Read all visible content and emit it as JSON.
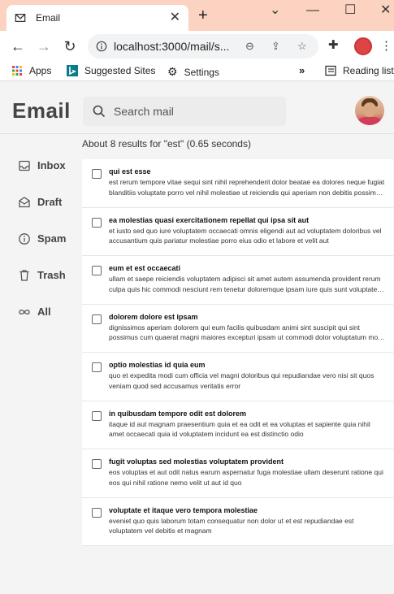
{
  "browser": {
    "tab_title": "Email",
    "url": "localhost:3000/mail/s...",
    "bookmarks": [
      {
        "label": "Apps",
        "icon": "apps-grid-icon"
      },
      {
        "label": "Suggested Sites",
        "icon": "bing-icon"
      },
      {
        "label": "Settings",
        "icon": "gear-icon"
      }
    ],
    "reading_list": "Reading list"
  },
  "app": {
    "logo": "Email",
    "search_placeholder": "Search mail",
    "results_text": "About 8 results for \"est\" (0.65 seconds)",
    "nav": [
      {
        "label": "Inbox",
        "icon": "inbox-icon"
      },
      {
        "label": "Draft",
        "icon": "draft-icon"
      },
      {
        "label": "Spam",
        "icon": "spam-icon"
      },
      {
        "label": "Trash",
        "icon": "trash-icon"
      },
      {
        "label": "All",
        "icon": "infinity-icon"
      }
    ],
    "mails": [
      {
        "subject": "qui est esse",
        "body": "est rerum tempore vitae sequi sint nihil reprehenderit dolor beatae ea dolores neque fugiat blanditiis voluptate porro vel nihil molestiae ut reiciendis qui aperiam non debitis possimus qui neque nisi nulla"
      },
      {
        "subject": "ea molestias quasi exercitationem repellat qui ipsa sit aut",
        "body": "et iusto sed quo iure voluptatem occaecati omnis eligendi aut ad voluptatem doloribus vel accusantium quis pariatur molestiae porro eius odio et labore et velit aut"
      },
      {
        "subject": "eum et est occaecati",
        "body": "ullam et saepe reiciendis voluptatem adipisci sit amet autem assumenda provident rerum culpa quis hic commodi nesciunt rem tenetur doloremque ipsam iure quis sunt voluptatem rerum illo velit"
      },
      {
        "subject": "dolorem dolore est ipsam",
        "body": "dignissimos aperiam dolorem qui eum facilis quibusdam animi sint suscipit qui sint possimus cum quaerat magni maiores excepturi ipsam ut commodi dolor voluptatum modi aut vitae"
      },
      {
        "subject": "optio molestias id quia eum",
        "body": "quo et expedita modi cum officia vel magni doloribus qui repudiandae vero nisi sit quos veniam quod sed accusamus veritatis error"
      },
      {
        "subject": "in quibusdam tempore odit est dolorem",
        "body": "itaque id aut magnam praesentium quia et ea odit et ea voluptas et sapiente quia nihil amet occaecati quia id voluptatem incidunt ea est distinctio odio"
      },
      {
        "subject": "fugit voluptas sed molestias voluptatem provident",
        "body": "eos voluptas et aut odit natus earum aspernatur fuga molestiae ullam deserunt ratione qui eos qui nihil ratione nemo velit ut aut id quo"
      },
      {
        "subject": "voluptate et itaque vero tempora molestiae",
        "body": "eveniet quo quis laborum totam consequatur non dolor ut et est repudiandae est voluptatem vel debitis et magnam"
      }
    ]
  }
}
